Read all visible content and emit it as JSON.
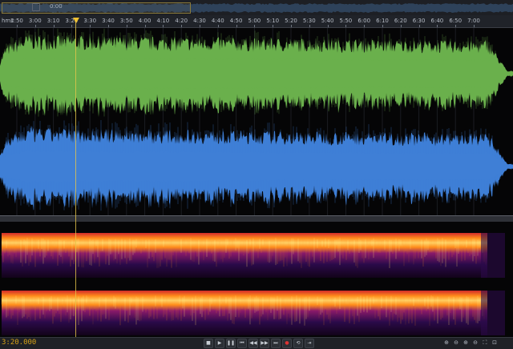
{
  "overview": {
    "zoom_readout": "0:00"
  },
  "ruler": {
    "unit": "hms",
    "ticks": [
      "2:50",
      "3:00",
      "3:10",
      "3:20",
      "3:30",
      "3:40",
      "3:50",
      "4:00",
      "4:10",
      "4:20",
      "4:30",
      "4:40",
      "4:50",
      "5:00",
      "5:10",
      "5:20",
      "5:30",
      "5:40",
      "5:50",
      "6:00",
      "6:10",
      "6:20",
      "6:30",
      "6:40",
      "6:50",
      "7:00"
    ]
  },
  "waveform": {
    "channels": [
      {
        "name": "left",
        "color": "#6ab04c"
      },
      {
        "name": "right",
        "color": "#3f7fd6"
      }
    ]
  },
  "spectral": {
    "colors": [
      "#2b0a4a",
      "#8a1a6a",
      "#d22a2a",
      "#ff8c1a",
      "#ffd66b"
    ]
  },
  "status": {
    "time": "3:20.000"
  },
  "transport": {
    "icons": [
      "stop-icon",
      "play-icon",
      "pause-icon",
      "go-start-icon",
      "rewind-icon",
      "fast-forward-icon",
      "go-end-icon",
      "record-icon",
      "loop-icon",
      "skip-icon"
    ]
  },
  "zoom_tools": {
    "icons": [
      "zoom-in-amplitude-icon",
      "zoom-out-amplitude-icon",
      "zoom-in-time-icon",
      "zoom-out-time-icon",
      "zoom-full-icon",
      "zoom-selection-icon"
    ]
  }
}
